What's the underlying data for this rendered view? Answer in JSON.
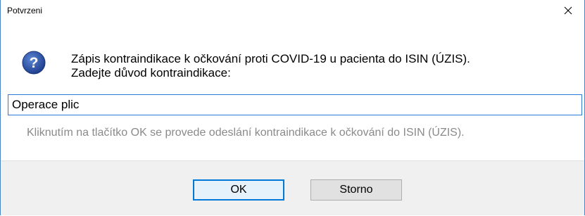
{
  "window": {
    "title": "Potvrzeni",
    "close_icon": "close-icon"
  },
  "message": {
    "icon": "question-icon",
    "line1": "Zápis kontraindikace k očkování proti COVID-19 u pacienta do ISIN (ÚZIS).",
    "line2": "Zadejte důvod kontraindikace:"
  },
  "reason_input": {
    "value": "Operace plic"
  },
  "hint": "Kliknutím na tlačítko OK se provede odeslání kontraindikace k očkování do ISIN (ÚZIS).",
  "buttons": {
    "ok_label": "OK",
    "cancel_label": "Storno"
  },
  "colors": {
    "accent": "#0078d7",
    "icon_blue": "#2a4fa0",
    "hint_gray": "#8a8a8a",
    "footer_bg": "#f0f0f0"
  }
}
